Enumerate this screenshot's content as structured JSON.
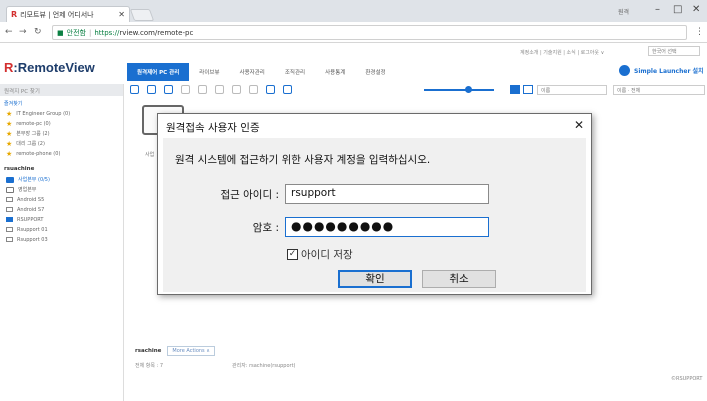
{
  "browser": {
    "tab_title": "리모트뷰 | 언제 어디서나",
    "url_secure": "안전함",
    "url_scheme": "https://",
    "url_rest": "rview.com/remote-pc",
    "window_user": "원격"
  },
  "header": {
    "top_links": "계정소개 | 기술지원 | 소식 | 로그아웃 ∨",
    "lang_select": "한국어 선택",
    "logo_prefix": "R",
    "logo_text": ":RemoteView",
    "nav": [
      "원격제어 PC 관리",
      "라이브뷰",
      "사용자관리",
      "조직관리",
      "사용통계",
      "환경설정"
    ],
    "launcher": "Simple Launcher 설치"
  },
  "sidebar": {
    "search": "원격지 PC 찾기",
    "favorites_title": "즐겨찾기",
    "favorites": [
      "IT Engineer Group (0)",
      "remote-pc (0)",
      "본부장 그룹 (2)",
      "대리 그룹 (2)",
      "remote-phone (0)"
    ],
    "group_title": "rsuachine",
    "groups": [
      "사업본부 (0/5)",
      "영업본부",
      "Android S5",
      "Android S7",
      "RSUPPORT",
      "Rsupport 01",
      "Rsupport 03"
    ]
  },
  "main": {
    "sort_select": "이름",
    "filter_select": "이름 · 전체",
    "footer_name": "rsachine",
    "footer_more": "More Actions ∧",
    "footer_count": "전체 항목 : 7",
    "footer_admin": "관리자: rsachine(rsupport)",
    "copyright": "©RSUPPORT",
    "bg_label": "사업"
  },
  "dialog": {
    "title": "원격접속 사용자 인증",
    "close": "✕",
    "message": "원격 시스템에 접근하기 위한 사용자 계정을 입력하십시오.",
    "id_label": "접근 아이디 :",
    "id_value": "rsupport",
    "pw_label": "암호 :",
    "pw_value": "●●●●●●●●●",
    "save_id_label": "아이디 저장",
    "save_id_checked": true,
    "ok": "확인",
    "cancel": "취소"
  }
}
